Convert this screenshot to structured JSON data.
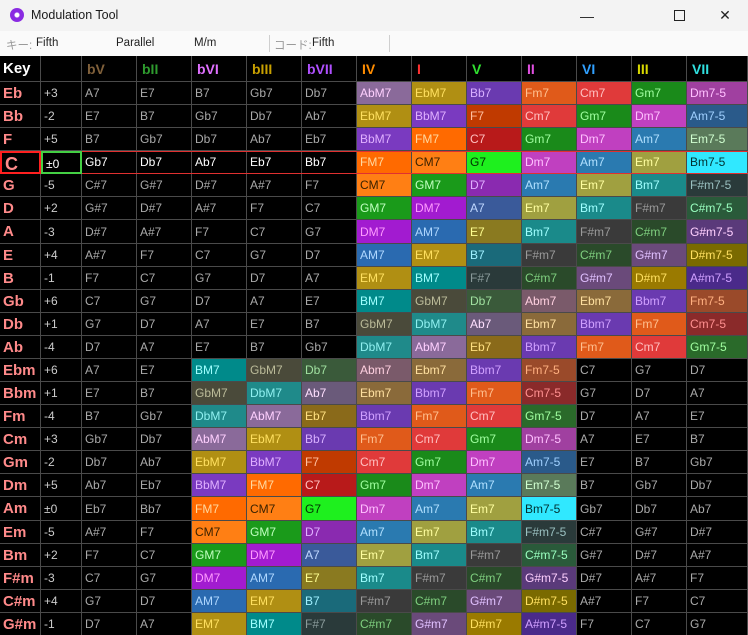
{
  "window": {
    "title": "Modulation Tool",
    "icon": "disc-icon",
    "controls": [
      "minimize-icon",
      "maximize-icon",
      "close-icon"
    ]
  },
  "toolbar": {
    "key_label": "キー:",
    "key_value": "Fifth",
    "parallel": "Parallel",
    "mode": "M/m",
    "chord_label": "コード:",
    "chord_value": "Fifth"
  },
  "colors": {
    "grid_bg": "#000000",
    "grid_line": "#4a4a4a",
    "key_text": "#ff8a8a",
    "offset_text": "#cccccc",
    "chord_text": "#aaaaaa",
    "selected_text": "#ffffff",
    "selected_row_border": "#e03030",
    "selected_key_border": "#ff2020",
    "selected_offset_border": "#44d044"
  },
  "table": {
    "key_header": "Key",
    "columns": [
      {
        "label": "bV",
        "color": "#80603a"
      },
      {
        "label": "bII",
        "color": "#2e9b2e"
      },
      {
        "label": "bVI",
        "color": "#e070ff"
      },
      {
        "label": "bIII",
        "color": "#c8a000"
      },
      {
        "label": "bVII",
        "color": "#b050ff"
      },
      {
        "label": "IV",
        "color": "#ff8c00"
      },
      {
        "label": "I",
        "color": "#ff3030"
      },
      {
        "label": "V",
        "color": "#30e030"
      },
      {
        "label": "II",
        "color": "#e050e0"
      },
      {
        "label": "VI",
        "color": "#30a0ff"
      },
      {
        "label": "III",
        "color": "#d8d800"
      },
      {
        "label": "VII",
        "color": "#30e0e0"
      }
    ],
    "selected_row": 3,
    "rows": [
      {
        "key": "Eb",
        "offset": "+3",
        "cells": [
          "A7",
          "E7",
          "B7",
          "Gb7",
          "Db7",
          "AbM7",
          "EbM7",
          "Bb7",
          "Fm7",
          "Cm7",
          "Gm7",
          "Dm7-5"
        ]
      },
      {
        "key": "Bb",
        "offset": "-2",
        "cells": [
          "E7",
          "B7",
          "Gb7",
          "Db7",
          "Ab7",
          "EbM7",
          "BbM7",
          "F7",
          "Cm7",
          "Gm7",
          "Dm7",
          "Am7-5"
        ]
      },
      {
        "key": "F",
        "offset": "+5",
        "cells": [
          "B7",
          "Gb7",
          "Db7",
          "Ab7",
          "Eb7",
          "BbM7",
          "FM7",
          "C7",
          "Gm7",
          "Dm7",
          "Am7",
          "Em7-5"
        ]
      },
      {
        "key": "C",
        "offset": "±0",
        "cells": [
          "Gb7",
          "Db7",
          "Ab7",
          "Eb7",
          "Bb7",
          "FM7",
          "CM7",
          "G7",
          "Dm7",
          "Am7",
          "Em7",
          "Bm7-5"
        ]
      },
      {
        "key": "G",
        "offset": "-5",
        "cells": [
          "C#7",
          "G#7",
          "D#7",
          "A#7",
          "F7",
          "CM7",
          "GM7",
          "D7",
          "Am7",
          "Em7",
          "Bm7",
          "F#m7-5"
        ]
      },
      {
        "key": "D",
        "offset": "+2",
        "cells": [
          "G#7",
          "D#7",
          "A#7",
          "F7",
          "C7",
          "GM7",
          "DM7",
          "A7",
          "Em7",
          "Bm7",
          "F#m7",
          "C#m7-5"
        ]
      },
      {
        "key": "A",
        "offset": "-3",
        "cells": [
          "D#7",
          "A#7",
          "F7",
          "C7",
          "G7",
          "DM7",
          "AM7",
          "E7",
          "Bm7",
          "F#m7",
          "C#m7",
          "G#m7-5"
        ]
      },
      {
        "key": "E",
        "offset": "+4",
        "cells": [
          "A#7",
          "F7",
          "C7",
          "G7",
          "D7",
          "AM7",
          "EM7",
          "B7",
          "F#m7",
          "C#m7",
          "G#m7",
          "D#m7-5"
        ]
      },
      {
        "key": "B",
        "offset": "-1",
        "cells": [
          "F7",
          "C7",
          "G7",
          "D7",
          "A7",
          "EM7",
          "BM7",
          "F#7",
          "C#m7",
          "G#m7",
          "D#m7",
          "A#m7-5"
        ]
      },
      {
        "key": "Gb",
        "offset": "+6",
        "cells": [
          "C7",
          "G7",
          "D7",
          "A7",
          "E7",
          "BM7",
          "GbM7",
          "Db7",
          "Abm7",
          "Ebm7",
          "Bbm7",
          "Fm7-5"
        ]
      },
      {
        "key": "Db",
        "offset": "+1",
        "cells": [
          "G7",
          "D7",
          "A7",
          "E7",
          "B7",
          "GbM7",
          "DbM7",
          "Ab7",
          "Ebm7",
          "Bbm7",
          "Fm7",
          "Cm7-5"
        ]
      },
      {
        "key": "Ab",
        "offset": "-4",
        "cells": [
          "D7",
          "A7",
          "E7",
          "B7",
          "Gb7",
          "DbM7",
          "AbM7",
          "Eb7",
          "Bbm7",
          "Fm7",
          "Cm7",
          "Gm7-5"
        ]
      },
      {
        "key": "Ebm",
        "offset": "+6",
        "cells": [
          "A7",
          "E7",
          "BM7",
          "GbM7",
          "Db7",
          "Abm7",
          "Ebm7",
          "Bbm7",
          "Fm7-5",
          "C7",
          "G7",
          "D7"
        ]
      },
      {
        "key": "Bbm",
        "offset": "+1",
        "cells": [
          "E7",
          "B7",
          "GbM7",
          "DbM7",
          "Ab7",
          "Ebm7",
          "Bbm7",
          "Fm7",
          "Cm7-5",
          "G7",
          "D7",
          "A7"
        ]
      },
      {
        "key": "Fm",
        "offset": "-4",
        "cells": [
          "B7",
          "Gb7",
          "DbM7",
          "AbM7",
          "Eb7",
          "Bbm7",
          "Fm7",
          "Cm7",
          "Gm7-5",
          "D7",
          "A7",
          "E7"
        ]
      },
      {
        "key": "Cm",
        "offset": "+3",
        "cells": [
          "Gb7",
          "Db7",
          "AbM7",
          "EbM7",
          "Bb7",
          "Fm7",
          "Cm7",
          "Gm7",
          "Dm7-5",
          "A7",
          "E7",
          "B7"
        ]
      },
      {
        "key": "Gm",
        "offset": "-2",
        "cells": [
          "Db7",
          "Ab7",
          "EbM7",
          "BbM7",
          "F7",
          "Cm7",
          "Gm7",
          "Dm7",
          "Am7-5",
          "E7",
          "B7",
          "Gb7"
        ]
      },
      {
        "key": "Dm",
        "offset": "+5",
        "cells": [
          "Ab7",
          "Eb7",
          "BbM7",
          "FM7",
          "C7",
          "Gm7",
          "Dm7",
          "Am7",
          "Em7-5",
          "B7",
          "Gb7",
          "Db7"
        ]
      },
      {
        "key": "Am",
        "offset": "±0",
        "cells": [
          "Eb7",
          "Bb7",
          "FM7",
          "CM7",
          "G7",
          "Dm7",
          "Am7",
          "Em7",
          "Bm7-5",
          "Gb7",
          "Db7",
          "Ab7"
        ]
      },
      {
        "key": "Em",
        "offset": "-5",
        "cells": [
          "A#7",
          "F7",
          "CM7",
          "GM7",
          "D7",
          "Am7",
          "Em7",
          "Bm7",
          "F#m7-5",
          "C#7",
          "G#7",
          "D#7"
        ]
      },
      {
        "key": "Bm",
        "offset": "+2",
        "cells": [
          "F7",
          "C7",
          "GM7",
          "DM7",
          "A7",
          "Em7",
          "Bm7",
          "F#m7",
          "C#m7-5",
          "G#7",
          "D#7",
          "A#7"
        ]
      },
      {
        "key": "F#m",
        "offset": "-3",
        "cells": [
          "C7",
          "G7",
          "DM7",
          "AM7",
          "E7",
          "Bm7",
          "F#m7",
          "C#m7",
          "G#m7-5",
          "D#7",
          "A#7",
          "F7"
        ]
      },
      {
        "key": "C#m",
        "offset": "+4",
        "cells": [
          "G7",
          "D7",
          "AM7",
          "EM7",
          "B7",
          "F#m7",
          "C#m7",
          "G#m7",
          "D#m7-5",
          "A#7",
          "F7",
          "C7"
        ]
      },
      {
        "key": "G#m",
        "offset": "-1",
        "cells": [
          "D7",
          "A7",
          "EM7",
          "BM7",
          "F#7",
          "C#m7",
          "G#m7",
          "D#m7",
          "A#m7-5",
          "F7",
          "C7",
          "G7"
        ]
      }
    ],
    "chord_styles": {
      "CM7": [
        "#ff7f14",
        "#3a2200"
      ],
      "DbM7": [
        "#1f8a8a",
        "#8ff0f0"
      ],
      "DM7": [
        "#a21bd0",
        "#ff9cff"
      ],
      "EbM7": [
        "#b08f13",
        "#ffe060"
      ],
      "EM7": [
        "#b08f13",
        "#ffe060"
      ],
      "FM7": [
        "#ff6a00",
        "#ffd9a0"
      ],
      "GbM7": [
        "#4a4a3a",
        "#bbbb99"
      ],
      "GM7": [
        "#1a9a1a",
        "#c0ffc0"
      ],
      "AbM7": [
        "#8a6a9a",
        "#ffd0ff"
      ],
      "AM7": [
        "#2a6ab0",
        "#b0d8ff"
      ],
      "BbM7": [
        "#7a3ac0",
        "#e0b0ff"
      ],
      "BM7": [
        "#008a8a",
        "#a0ffff"
      ],
      "Cm7": [
        "#e03a3a",
        "#ffc0c0"
      ],
      "C#m7": [
        "#2a4a2a",
        "#7fcf7f"
      ],
      "Dm7": [
        "#c040c0",
        "#ffc0ff"
      ],
      "Ebm7": [
        "#8a6a3a",
        "#ffe0a0"
      ],
      "Em7": [
        "#a0a040",
        "#ffffa0"
      ],
      "Fm7": [
        "#e05a1a",
        "#ffc090"
      ],
      "F#m7": [
        "#3a3a3a",
        "#9a9a9a"
      ],
      "Gm7": [
        "#1a8a1a",
        "#a0ffa0"
      ],
      "G#m7": [
        "#6a4a7a",
        "#e0c0ff"
      ],
      "Abm7": [
        "#7a5a6a",
        "#ffd0e0"
      ],
      "Am7": [
        "#2a7ab0",
        "#b0e0ff"
      ],
      "Bbm7": [
        "#6a3ab0",
        "#d0a0ff"
      ],
      "Bm7": [
        "#1a8a8a",
        "#a0ffff"
      ],
      "D#m7": [
        "#9a7a00",
        "#ffe060"
      ],
      "Bm7-5": [
        "#30e8ff",
        "#003030"
      ],
      "Em7-5": [
        "#5a7a5a",
        "#d0ffd0"
      ],
      "F#m7-5": [
        "#2a3a3a",
        "#9ac0c0"
      ],
      "C#m7-5": [
        "#2a5a3a",
        "#9affc0"
      ],
      "G#m7-5": [
        "#5a3a7a",
        "#ffd0ff"
      ],
      "D#m7-5": [
        "#7a6a00",
        "#ffe060"
      ],
      "A#m7-5": [
        "#4a2a8a",
        "#d0a0ff"
      ],
      "Fm7-5": [
        "#9a4a2a",
        "#ffb080"
      ],
      "Cm7-5": [
        "#8a2a2a",
        "#ff9090"
      ],
      "Gm7-5": [
        "#2a6a2a",
        "#a0ffa0"
      ],
      "Dm7-5": [
        "#a040a0",
        "#ffc0ff"
      ],
      "Am7-5": [
        "#2a5a8a",
        "#a0d0ff"
      ],
      "G7": [
        "#1ef01e",
        "#003000"
      ],
      "D7": [
        "#8a2ab0",
        "#e0b0ff"
      ],
      "A7": [
        "#3a5a9a",
        "#c0d8ff"
      ],
      "E7": [
        "#8a7a20",
        "#ffff90"
      ],
      "B7": [
        "#1a6a7a",
        "#a0f0ff"
      ],
      "F#7": [
        "#2a3a3a",
        "#8a9a9a"
      ],
      "Db7": [
        "#3a5a3a",
        "#a0e0a0"
      ],
      "Ab7": [
        "#6a5a7a",
        "#ffe0ff"
      ],
      "Eb7": [
        "#8a6a1a",
        "#ffe080"
      ],
      "Bb7": [
        "#6a3ab0",
        "#d8b0ff"
      ],
      "F7": [
        "#c03a00",
        "#ffc0a0"
      ],
      "C7": [
        "#b81a1a",
        "#ffc0c0"
      ],
      "Gb7": [
        "#3a3a2a",
        "#c0c0a0"
      ],
      "C#7": [
        "#2a3a2a",
        "#80b080"
      ],
      "G#7": [
        "#3a2a3a",
        "#c090c0"
      ],
      "D#7": [
        "#3a3a2a",
        "#c0c080"
      ],
      "A#7": [
        "#2a2a3a",
        "#a0a0d0"
      ]
    }
  }
}
